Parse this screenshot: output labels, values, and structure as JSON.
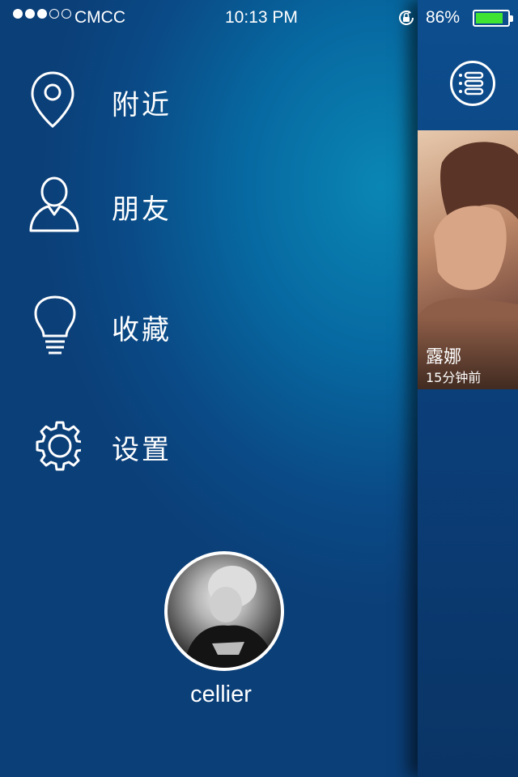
{
  "status_bar": {
    "carrier": "CMCC",
    "time": "10:13 PM",
    "battery_percent": "86%",
    "battery_level": 0.86,
    "signal_bars_filled": 3,
    "signal_bars_total": 5,
    "battery_color": "#3fe332"
  },
  "menu": {
    "items": [
      {
        "label": "附近",
        "icon": "location-pin-icon"
      },
      {
        "label": "朋友",
        "icon": "user-icon"
      },
      {
        "label": "收藏",
        "icon": "lightbulb-icon"
      },
      {
        "label": "设置",
        "icon": "gear-icon"
      }
    ]
  },
  "profile": {
    "username": "cellier"
  },
  "right_panel": {
    "menu_icon": "list-menu-icon",
    "card": {
      "name": "露娜",
      "time": "15分钟前"
    }
  }
}
